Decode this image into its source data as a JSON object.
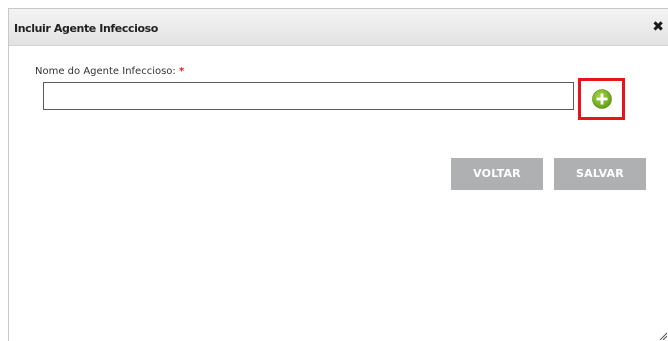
{
  "dialog": {
    "title": "Incluir Agente Infeccioso",
    "close_symbol": "✖"
  },
  "form": {
    "name_label": "Nome do Agente Infeccioso:",
    "required_marker": "*",
    "name_value": "",
    "name_placeholder": ""
  },
  "actions": {
    "add_icon": "plus-circle-icon",
    "back_label": "VOLTAR",
    "save_label": "SALVAR"
  },
  "colors": {
    "add_icon": "#7ab51d",
    "highlight": "#e8141c",
    "button_bg": "#aeb0b2"
  }
}
